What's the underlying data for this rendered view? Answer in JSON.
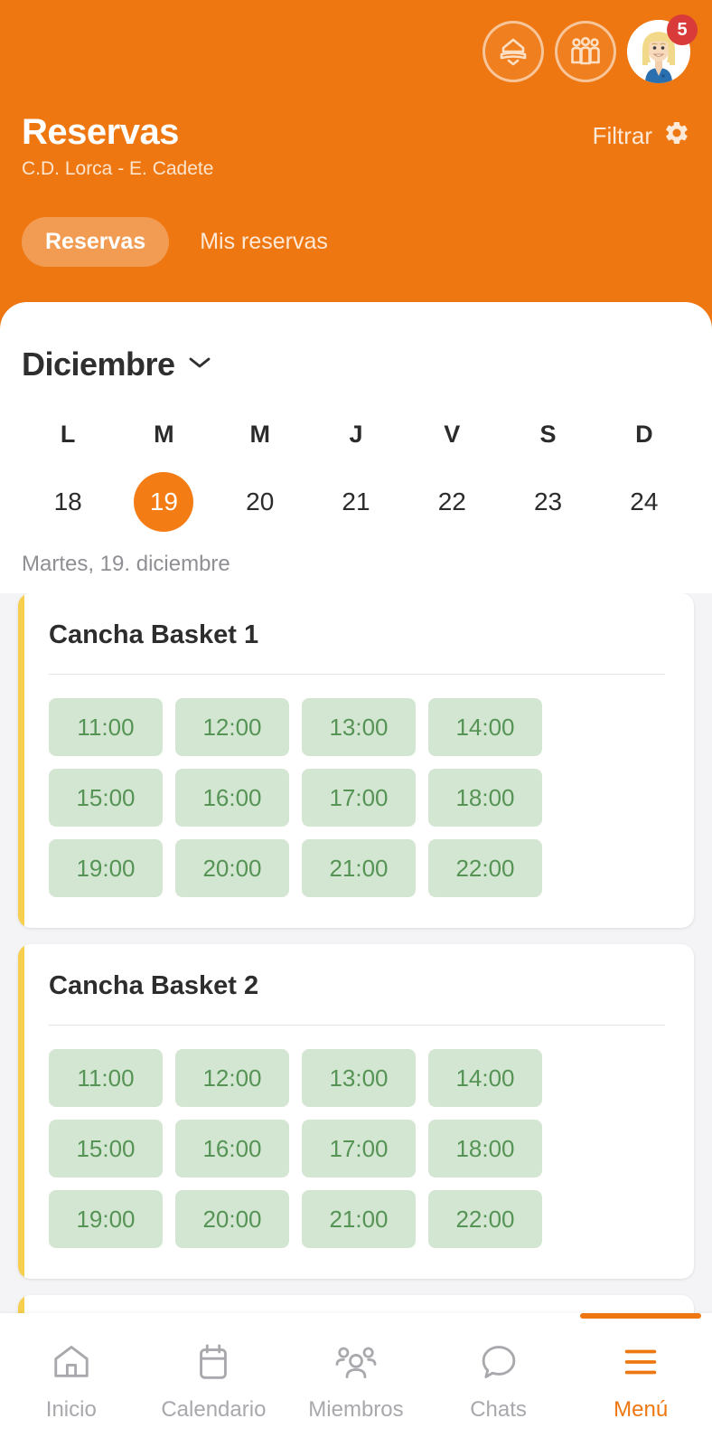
{
  "theme": {
    "brand_orange": "#ee7711",
    "selected_day_orange": "#f47c14",
    "card_accent_yellow": "#f5cf4d",
    "slot_bg_green": "#d3e6d1",
    "slot_text_green": "#569456",
    "badge_red": "#d93b3b"
  },
  "header": {
    "title": "Reservas",
    "subtitle": "C.D. Lorca - E. Cadete",
    "filter_label": "Filtrar",
    "icons": [
      {
        "name": "club-shield-icon"
      },
      {
        "name": "team-group-icon"
      },
      {
        "name": "user-avatar"
      }
    ],
    "notification_count": "5",
    "tabs": [
      {
        "label": "Reservas",
        "active": true
      },
      {
        "label": "Mis reservas",
        "active": false
      }
    ]
  },
  "calendar": {
    "month": "Diciembre",
    "day_initials": [
      "L",
      "M",
      "M",
      "J",
      "V",
      "S",
      "D"
    ],
    "dates": [
      {
        "num": "18",
        "selected": false
      },
      {
        "num": "19",
        "selected": true
      },
      {
        "num": "20",
        "selected": false
      },
      {
        "num": "21",
        "selected": false
      },
      {
        "num": "22",
        "selected": false
      },
      {
        "num": "23",
        "selected": false
      },
      {
        "num": "24",
        "selected": false
      }
    ],
    "selected_day_label": "Martes, 19. diciembre"
  },
  "courts": [
    {
      "name": "Cancha Basket 1",
      "slots": [
        "11:00",
        "12:00",
        "13:00",
        "14:00",
        "15:00",
        "16:00",
        "17:00",
        "18:00",
        "19:00",
        "20:00",
        "21:00",
        "22:00"
      ]
    },
    {
      "name": "Cancha Basket 2",
      "slots": [
        "11:00",
        "12:00",
        "13:00",
        "14:00",
        "15:00",
        "16:00",
        "17:00",
        "18:00",
        "19:00",
        "20:00",
        "21:00",
        "22:00"
      ]
    },
    {
      "name": "",
      "slots": []
    }
  ],
  "bottom_nav": [
    {
      "label": "Inicio",
      "icon": "home-icon",
      "active": false
    },
    {
      "label": "Calendario",
      "icon": "calendar-icon",
      "active": false
    },
    {
      "label": "Miembros",
      "icon": "people-icon",
      "active": false
    },
    {
      "label": "Chats",
      "icon": "chat-bubble-icon",
      "active": false
    },
    {
      "label": "Menú",
      "icon": "hamburger-menu-icon",
      "active": true
    }
  ]
}
